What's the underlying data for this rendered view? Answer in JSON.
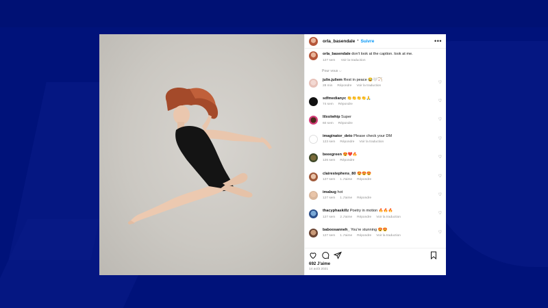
{
  "post": {
    "author": "orla_basendale",
    "separator": "•",
    "follow_label": "Suivre",
    "more_label": "•••",
    "caption": {
      "author": "orla_basendale",
      "text": "don't look at the caption. look at me.",
      "time": "127 sem",
      "translate": "Voir la traduction"
    },
    "filter_label": "Pour vous ⌵",
    "likes": "692 J'aime",
    "date": "14 août 2021"
  },
  "comments": [
    {
      "user": "julie.juliem",
      "text": "Rest in peace 😂🤍🏹",
      "time": "28 min",
      "reply": "Répondre",
      "translate": "Voir la traduction",
      "likes": ""
    },
    {
      "user": "sdfmedianyc",
      "text": "👏👏👏👏🙏",
      "time": "74 sem",
      "reply": "Répondre",
      "translate": "",
      "likes": ""
    },
    {
      "user": "lilxolwhip",
      "text": "Super",
      "time": "60 sem",
      "reply": "Répondre",
      "translate": "",
      "likes": ""
    },
    {
      "user": "imaginator_deto",
      "text": "Please check your DM",
      "time": "123 sem",
      "reply": "Répondre",
      "translate": "Voir la traduction",
      "likes": ""
    },
    {
      "user": "beeegreen",
      "text": "😍❤️🔥",
      "time": "126 sem",
      "reply": "Répondre",
      "translate": "",
      "likes": ""
    },
    {
      "user": "clairestephens_80",
      "text": "😍😍😍",
      "time": "127 sem",
      "reply": "Répondre",
      "translate": "",
      "likes": "1 J'aime"
    },
    {
      "user": "imabug",
      "text": "hot",
      "time": "127 sem",
      "reply": "Répondre",
      "translate": "",
      "likes": "1 J'aime"
    },
    {
      "user": "thacyphaskillz",
      "text": "Poetry in motion 🔥🔥🔥",
      "time": "127 sem",
      "reply": "Répondre",
      "translate": "Voir la traduction",
      "likes": "2 J'aime"
    },
    {
      "user": "baboosanneh_",
      "text": "You're stunning 😍😍",
      "time": "127 sem",
      "reply": "Répondre",
      "translate": "Voir la traduction",
      "likes": "1 J'aime"
    }
  ],
  "icons": {
    "heart": "heart-icon",
    "comment": "comment-icon",
    "share": "share-icon",
    "save": "bookmark-icon"
  },
  "colors": {
    "background": "#00127a",
    "link": "#0095f6",
    "meta": "#8e8e8e"
  }
}
